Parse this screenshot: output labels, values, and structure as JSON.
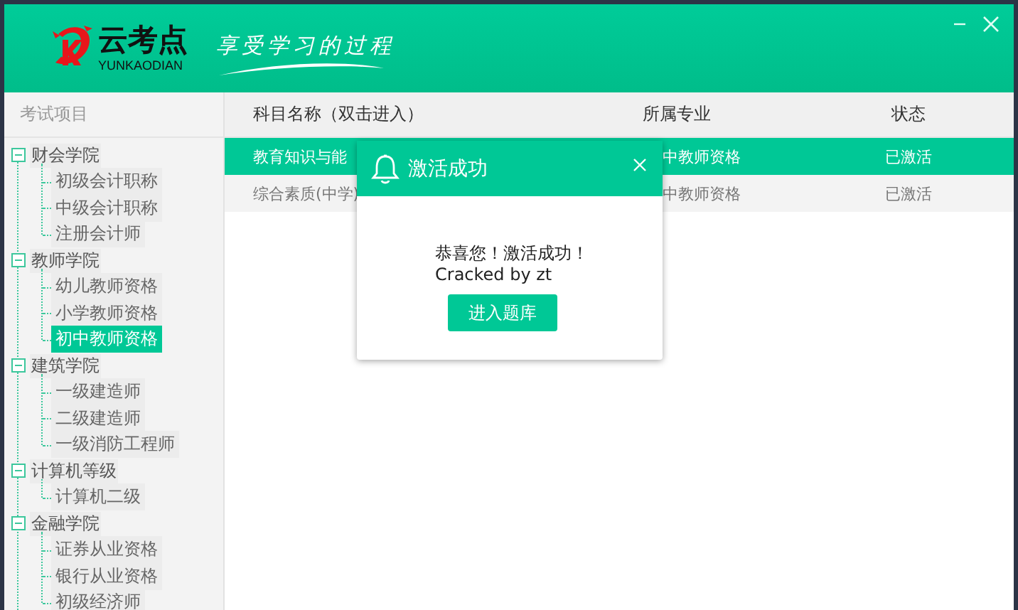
{
  "window": {
    "brand": "云考点",
    "brand_subtitle": "YUNKAODIAN",
    "slogan": "享受学习的过程"
  },
  "sidebar": {
    "title": "考试项目",
    "groups": [
      {
        "label": "财会学院",
        "expanded": true,
        "children": [
          {
            "label": "初级会计职称",
            "selected": false
          },
          {
            "label": "中级会计职称",
            "selected": false
          },
          {
            "label": "注册会计师",
            "selected": false
          }
        ]
      },
      {
        "label": "教师学院",
        "expanded": true,
        "children": [
          {
            "label": "幼儿教师资格",
            "selected": false
          },
          {
            "label": "小学教师资格",
            "selected": false
          },
          {
            "label": "初中教师资格",
            "selected": true
          }
        ]
      },
      {
        "label": "建筑学院",
        "expanded": true,
        "children": [
          {
            "label": "一级建造师",
            "selected": false
          },
          {
            "label": "二级建造师",
            "selected": false
          },
          {
            "label": "一级消防工程师",
            "selected": false
          }
        ]
      },
      {
        "label": "计算机等级",
        "expanded": true,
        "children": [
          {
            "label": "计算机二级",
            "selected": false
          }
        ]
      },
      {
        "label": "金融学院",
        "expanded": true,
        "children": [
          {
            "label": "证券从业资格",
            "selected": false
          },
          {
            "label": "银行从业资格",
            "selected": false
          },
          {
            "label": "初级经济师",
            "selected": false
          }
        ]
      }
    ]
  },
  "table": {
    "columns": [
      "科目名称（双击进入）",
      "所属专业",
      "状态"
    ],
    "rows": [
      {
        "cells": [
          "教育知识与能",
          "中教师资格",
          "已激活"
        ],
        "selected": true
      },
      {
        "cells": [
          "综合素质(中学)",
          "中教师资格",
          "已激活"
        ],
        "selected": false
      }
    ]
  },
  "dialog": {
    "title": "激活成功",
    "message": [
      "恭喜您！激活成功！",
      "Cracked by zt"
    ],
    "button": "进入题库"
  }
}
